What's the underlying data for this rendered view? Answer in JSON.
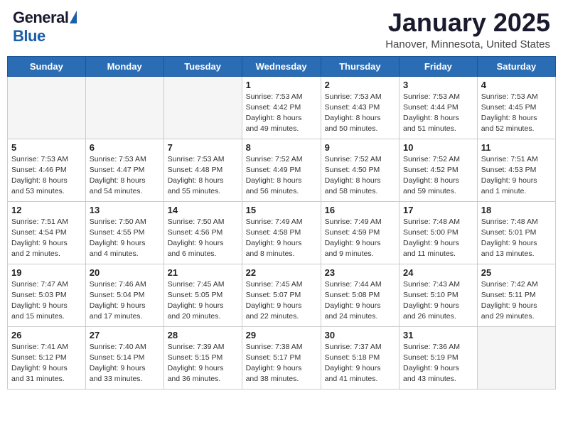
{
  "header": {
    "logo_general": "General",
    "logo_blue": "Blue",
    "month": "January 2025",
    "location": "Hanover, Minnesota, United States"
  },
  "days_of_week": [
    "Sunday",
    "Monday",
    "Tuesday",
    "Wednesday",
    "Thursday",
    "Friday",
    "Saturday"
  ],
  "weeks": [
    [
      {
        "day": "",
        "info": ""
      },
      {
        "day": "",
        "info": ""
      },
      {
        "day": "",
        "info": ""
      },
      {
        "day": "1",
        "info": "Sunrise: 7:53 AM\nSunset: 4:42 PM\nDaylight: 8 hours\nand 49 minutes."
      },
      {
        "day": "2",
        "info": "Sunrise: 7:53 AM\nSunset: 4:43 PM\nDaylight: 8 hours\nand 50 minutes."
      },
      {
        "day": "3",
        "info": "Sunrise: 7:53 AM\nSunset: 4:44 PM\nDaylight: 8 hours\nand 51 minutes."
      },
      {
        "day": "4",
        "info": "Sunrise: 7:53 AM\nSunset: 4:45 PM\nDaylight: 8 hours\nand 52 minutes."
      }
    ],
    [
      {
        "day": "5",
        "info": "Sunrise: 7:53 AM\nSunset: 4:46 PM\nDaylight: 8 hours\nand 53 minutes."
      },
      {
        "day": "6",
        "info": "Sunrise: 7:53 AM\nSunset: 4:47 PM\nDaylight: 8 hours\nand 54 minutes."
      },
      {
        "day": "7",
        "info": "Sunrise: 7:53 AM\nSunset: 4:48 PM\nDaylight: 8 hours\nand 55 minutes."
      },
      {
        "day": "8",
        "info": "Sunrise: 7:52 AM\nSunset: 4:49 PM\nDaylight: 8 hours\nand 56 minutes."
      },
      {
        "day": "9",
        "info": "Sunrise: 7:52 AM\nSunset: 4:50 PM\nDaylight: 8 hours\nand 58 minutes."
      },
      {
        "day": "10",
        "info": "Sunrise: 7:52 AM\nSunset: 4:52 PM\nDaylight: 8 hours\nand 59 minutes."
      },
      {
        "day": "11",
        "info": "Sunrise: 7:51 AM\nSunset: 4:53 PM\nDaylight: 9 hours\nand 1 minute."
      }
    ],
    [
      {
        "day": "12",
        "info": "Sunrise: 7:51 AM\nSunset: 4:54 PM\nDaylight: 9 hours\nand 2 minutes."
      },
      {
        "day": "13",
        "info": "Sunrise: 7:50 AM\nSunset: 4:55 PM\nDaylight: 9 hours\nand 4 minutes."
      },
      {
        "day": "14",
        "info": "Sunrise: 7:50 AM\nSunset: 4:56 PM\nDaylight: 9 hours\nand 6 minutes."
      },
      {
        "day": "15",
        "info": "Sunrise: 7:49 AM\nSunset: 4:58 PM\nDaylight: 9 hours\nand 8 minutes."
      },
      {
        "day": "16",
        "info": "Sunrise: 7:49 AM\nSunset: 4:59 PM\nDaylight: 9 hours\nand 9 minutes."
      },
      {
        "day": "17",
        "info": "Sunrise: 7:48 AM\nSunset: 5:00 PM\nDaylight: 9 hours\nand 11 minutes."
      },
      {
        "day": "18",
        "info": "Sunrise: 7:48 AM\nSunset: 5:01 PM\nDaylight: 9 hours\nand 13 minutes."
      }
    ],
    [
      {
        "day": "19",
        "info": "Sunrise: 7:47 AM\nSunset: 5:03 PM\nDaylight: 9 hours\nand 15 minutes."
      },
      {
        "day": "20",
        "info": "Sunrise: 7:46 AM\nSunset: 5:04 PM\nDaylight: 9 hours\nand 17 minutes."
      },
      {
        "day": "21",
        "info": "Sunrise: 7:45 AM\nSunset: 5:05 PM\nDaylight: 9 hours\nand 20 minutes."
      },
      {
        "day": "22",
        "info": "Sunrise: 7:45 AM\nSunset: 5:07 PM\nDaylight: 9 hours\nand 22 minutes."
      },
      {
        "day": "23",
        "info": "Sunrise: 7:44 AM\nSunset: 5:08 PM\nDaylight: 9 hours\nand 24 minutes."
      },
      {
        "day": "24",
        "info": "Sunrise: 7:43 AM\nSunset: 5:10 PM\nDaylight: 9 hours\nand 26 minutes."
      },
      {
        "day": "25",
        "info": "Sunrise: 7:42 AM\nSunset: 5:11 PM\nDaylight: 9 hours\nand 29 minutes."
      }
    ],
    [
      {
        "day": "26",
        "info": "Sunrise: 7:41 AM\nSunset: 5:12 PM\nDaylight: 9 hours\nand 31 minutes."
      },
      {
        "day": "27",
        "info": "Sunrise: 7:40 AM\nSunset: 5:14 PM\nDaylight: 9 hours\nand 33 minutes."
      },
      {
        "day": "28",
        "info": "Sunrise: 7:39 AM\nSunset: 5:15 PM\nDaylight: 9 hours\nand 36 minutes."
      },
      {
        "day": "29",
        "info": "Sunrise: 7:38 AM\nSunset: 5:17 PM\nDaylight: 9 hours\nand 38 minutes."
      },
      {
        "day": "30",
        "info": "Sunrise: 7:37 AM\nSunset: 5:18 PM\nDaylight: 9 hours\nand 41 minutes."
      },
      {
        "day": "31",
        "info": "Sunrise: 7:36 AM\nSunset: 5:19 PM\nDaylight: 9 hours\nand 43 minutes."
      },
      {
        "day": "",
        "info": ""
      }
    ]
  ]
}
